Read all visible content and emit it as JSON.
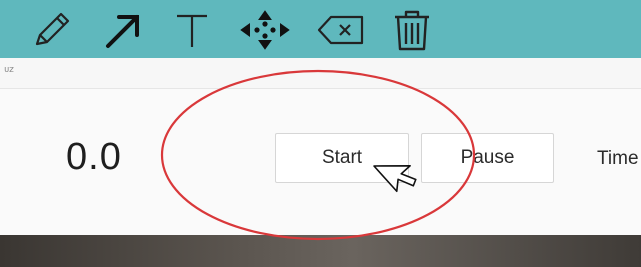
{
  "toolbar": {
    "tools": [
      {
        "icon": "pencil-icon"
      },
      {
        "icon": "arrow-icon"
      },
      {
        "icon": "text-tool-icon"
      },
      {
        "icon": "move-icon"
      },
      {
        "icon": "backspace-icon"
      },
      {
        "icon": "trash-icon"
      }
    ],
    "background_color": "#5fb8bd"
  },
  "subbar": {
    "text": "ᴜᴢ"
  },
  "stopwatch": {
    "time_display": "0.0",
    "start_label": "Start",
    "pause_label": "Pause",
    "timer_label": "Time"
  },
  "annotations": {
    "highlight_color": "#d9383a",
    "highlight_shape": "ellipse",
    "cursor": "arrow-cursor"
  }
}
